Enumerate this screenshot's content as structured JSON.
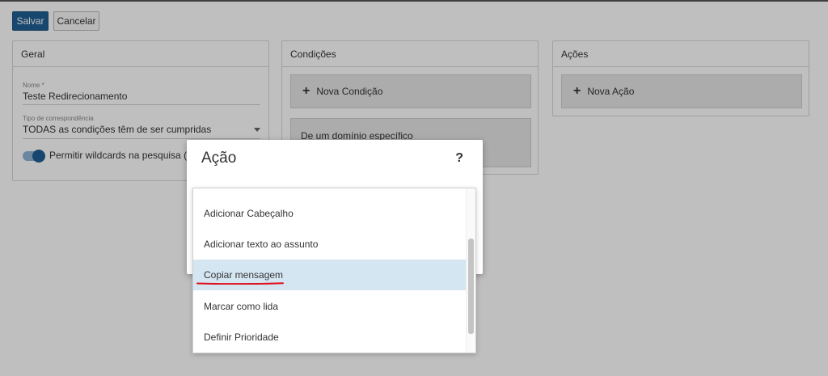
{
  "toolbar": {
    "save_label": "Salvar",
    "cancel_label": "Cancelar"
  },
  "geral": {
    "title": "Geral",
    "name_label": "Nome *",
    "name_value": "Teste Redirecionamento",
    "match_label": "Tipo de correspondência",
    "match_value": "TODAS as condições têm de ser cumpridas",
    "wildcard_label": "Permitir wildcards na pesquisa ( * e",
    "wildcard_enabled": true
  },
  "condicoes": {
    "title": "Condições",
    "add_label": "Nova Condição",
    "item_label": "De um domínio específico"
  },
  "acoes": {
    "title": "Ações",
    "add_label": "Nova Ação"
  },
  "dialog": {
    "title": "Ação",
    "help": "?"
  },
  "dropdown": {
    "items": [
      "Adicionar Cabeçalho",
      "Adicionar texto ao assunto",
      "Copiar mensagem",
      "Marcar como lida",
      "Definir Prioridade"
    ],
    "selected_index": 2
  },
  "colors": {
    "accent": "#1f5f93",
    "selected_bg": "#d5e6f3",
    "highlight": "#e0101e"
  }
}
